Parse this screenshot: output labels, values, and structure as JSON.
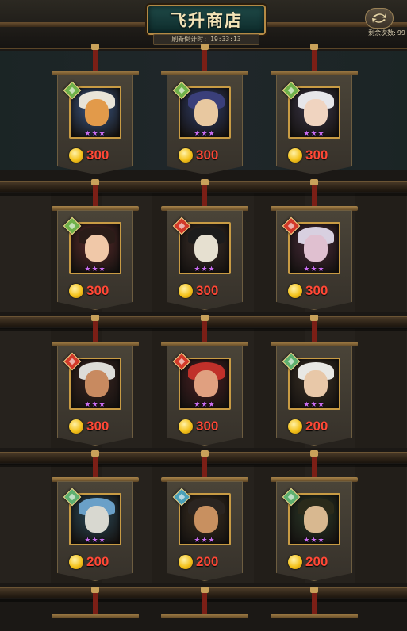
{
  "header": {
    "title": "飞升商店",
    "timer_label": "刷新倒计时:",
    "timer_value": "19:33:13",
    "remaining_label": "剩余次数:",
    "remaining_value": "99",
    "refresh_icon": "refresh-arrows-icon"
  },
  "colors": {
    "price_text": "#ff4836",
    "frame_gold": "#c89b44",
    "title_bg": "#1f4a48"
  },
  "items": [
    {
      "element": "wood",
      "element_color": "#6fb14a",
      "price": "300",
      "stars": "★★★",
      "palette": {
        "bg": "#3b5a8a",
        "hair": "#e8e4d8",
        "face": "#e29a4a"
      }
    },
    {
      "element": "wood",
      "element_color": "#6fb14a",
      "price": "300",
      "stars": "★★★",
      "palette": {
        "bg": "#2f3d6a",
        "hair": "#3a3f7a",
        "face": "#e8c8a0"
      }
    },
    {
      "element": "wood",
      "element_color": "#6fb14a",
      "price": "300",
      "stars": "★★★",
      "palette": {
        "bg": "#3a3548",
        "hair": "#e6e6ea",
        "face": "#f0d4c0"
      }
    },
    {
      "element": "wood",
      "element_color": "#6fb14a",
      "price": "300",
      "stars": "★★★",
      "palette": {
        "bg": "#5a2a2a",
        "hair": "#2a1c18",
        "face": "#f0c8a8"
      }
    },
    {
      "element": "fire",
      "element_color": "#d23a2a",
      "price": "300",
      "stars": "★★★",
      "palette": {
        "bg": "#3a2e28",
        "hair": "#1c1c1c",
        "face": "#e6e0d0"
      }
    },
    {
      "element": "fire",
      "element_color": "#d23a2a",
      "price": "300",
      "stars": "★★★",
      "palette": {
        "bg": "#4a2a3a",
        "hair": "#d8d0e0",
        "face": "#e0c0d0"
      }
    },
    {
      "element": "fire",
      "element_color": "#d23a2a",
      "price": "300",
      "stars": "★★★",
      "palette": {
        "bg": "#3a2420",
        "hair": "#dcdcd8",
        "face": "#c88a60"
      }
    },
    {
      "element": "fire",
      "element_color": "#d23a2a",
      "price": "300",
      "stars": "★★★",
      "palette": {
        "bg": "#4a1e22",
        "hair": "#c0302a",
        "face": "#e0a080"
      }
    },
    {
      "element": "wind",
      "element_color": "#5fb070",
      "price": "200",
      "stars": "★★★",
      "palette": {
        "bg": "#3a3024",
        "hair": "#e8e8e4",
        "face": "#e8c8a8"
      }
    },
    {
      "element": "wind",
      "element_color": "#5fb070",
      "price": "200",
      "stars": "★★★",
      "palette": {
        "bg": "#2a4a5a",
        "hair": "#6aa0c8",
        "face": "#d8d8d0"
      }
    },
    {
      "element": "water",
      "element_color": "#4aa0b8",
      "price": "200",
      "stars": "★★★",
      "palette": {
        "bg": "#3a2e20",
        "hair": "#2a2420",
        "face": "#c89060"
      }
    },
    {
      "element": "wind",
      "element_color": "#5fb070",
      "price": "200",
      "stars": "★★★",
      "palette": {
        "bg": "#2a3a28",
        "hair": "#2a2a1a",
        "face": "#d8b890"
      }
    }
  ]
}
